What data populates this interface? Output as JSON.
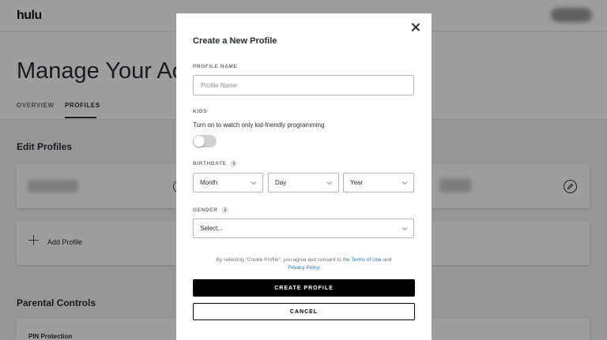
{
  "app": {
    "logo": "hulu"
  },
  "page": {
    "title": "Manage Your Acc",
    "tabs": [
      {
        "label": "OVERVIEW"
      },
      {
        "label": "PROFILES"
      }
    ],
    "edit_profiles_title": "Edit Profiles",
    "add_profile_label": "Add Profile",
    "parental_controls_title": "Parental Controls",
    "pin_protection_label": "PIN Protection"
  },
  "modal": {
    "title": "Create a New Profile",
    "profile_name": {
      "label": "PROFILE NAME",
      "placeholder": "Profile Name",
      "value": ""
    },
    "kids": {
      "label": "KIDS",
      "description": "Turn on to watch only kid-friendly programming",
      "enabled": false
    },
    "birthdate": {
      "label": "BIRTHDATE",
      "month": "Month",
      "day": "Day",
      "year": "Year"
    },
    "gender": {
      "label": "GENDER",
      "value": "Select..."
    },
    "consent": {
      "prefix": "By selecting \"Create Profile\", you agree and consent to the ",
      "terms_link": "Terms of Use",
      "and": " and ",
      "privacy_link": "Privacy Policy"
    },
    "create_button": "CREATE PROFILE",
    "cancel_button": "CANCEL"
  },
  "colors": {
    "overlay": "#000000",
    "primary_button": "#000000",
    "link": "#1a6fb8",
    "toggle_off": "#cfd1d4"
  }
}
